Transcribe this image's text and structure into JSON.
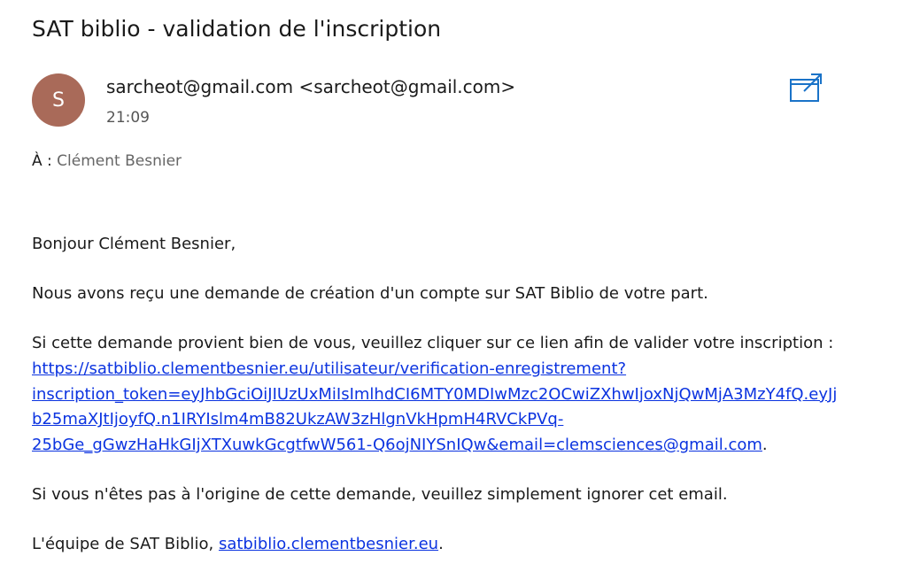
{
  "email": {
    "subject": "SAT biblio - validation de l'inscription",
    "avatar_letter": "S",
    "avatar_color": "#a96a59",
    "sender": "sarcheot@gmail.com <sarcheot@gmail.com>",
    "time": "21:09",
    "to_label": "À :",
    "to_name": "Clément Besnier",
    "popout_icon": "open-in-new-window-icon"
  },
  "body": {
    "greeting": "Bonjour Clément Besnier,",
    "request": "Nous avons reçu une demande de création d'un compte sur SAT Biblio de votre part.",
    "instruction": "Si cette demande provient bien de vous, veuillez cliquer sur ce lien afin de valider votre inscription :",
    "verification_link": {
      "line1": "https://satbiblio.clementbesnier.eu/utilisateur/verification-enregistrement?",
      "line2": "inscription_token=eyJhbGciOiJIUzUxMiIsImlhdCI6MTY0MDIwMzc2OCwiZXhwIjoxNjQwMjA3MzY4fQ.eyJj",
      "line3": "b25maXJtIjoyfQ.n1IRYIslm4mB82UkzAW3zHlgnVkHpmH4RVCkPVq-",
      "line4": "25bGe_gGwzHaHkGIjXTXuwkGcgtfwW561-Q6ojNIYSnIQw&email=clemsciences@gmail.com",
      "trailing": "."
    },
    "ignore": "Si vous n'êtes pas à l'origine de cette demande, veuillez simplement ignorer cet email.",
    "signature_prefix": "L'équipe de SAT Biblio, ",
    "signature_link": "satbiblio.clementbesnier.eu",
    "signature_suffix": "."
  },
  "colors": {
    "link": "#0b33e0",
    "accent": "#1a73c8"
  }
}
